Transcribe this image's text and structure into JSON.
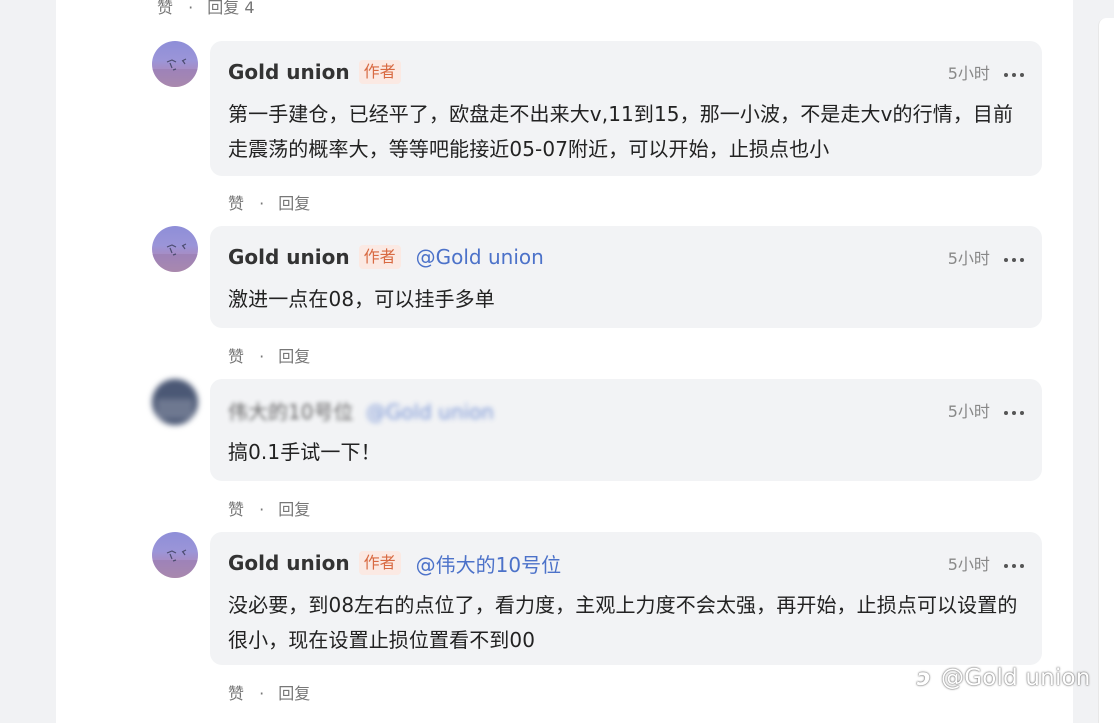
{
  "top_actions": {
    "like": "赞",
    "dot": "·",
    "reply": "回复 4"
  },
  "comments": [
    {
      "author": "Gold union",
      "badge": "作者",
      "mention": "",
      "time": "5小时",
      "text": "第一手建仓，已经平了，欧盘走不出来大v,11到15，那一小波，不是走大v的行情，目前走震荡的概率大，等等吧能接近05-07附近，可以开始，止损点也小",
      "like": "赞",
      "dot": "·",
      "reply": "回复"
    },
    {
      "author": "Gold union",
      "badge": "作者",
      "mention": "@Gold union",
      "time": "5小时",
      "text": "激进一点在08，可以挂手多单",
      "like": "赞",
      "dot": "·",
      "reply": "回复"
    },
    {
      "author": "伟大的10号位",
      "badge": "",
      "mention": "@Gold union",
      "time": "5小时",
      "text": "搞0.1手试一下！",
      "like": "赞",
      "dot": "·",
      "reply": "回复"
    },
    {
      "author": "Gold union",
      "badge": "作者",
      "mention": "@伟大的10号位",
      "time": "5小时",
      "text": "没必要，到08左右的点位了，看力度，主观上力度不会太强，再开始，止损点可以设置的很小，现在设置止损位置看不到00",
      "like": "赞",
      "dot": "·",
      "reply": "回复"
    }
  ],
  "watermark": {
    "icon": "ↄ",
    "text": "@Gold union"
  },
  "icons": {
    "avatar": "sunset-birds-avatar-icon",
    "blurred_avatar": "blurred-user-avatar-icon",
    "more": "more-dots-icon"
  },
  "colors": {
    "background": "#f1f2f4",
    "panel": "#ffffff",
    "bubble": "#f2f3f5",
    "author_badge": "#d86a42",
    "mention": "#4c72c9",
    "muted_text": "#777777"
  }
}
